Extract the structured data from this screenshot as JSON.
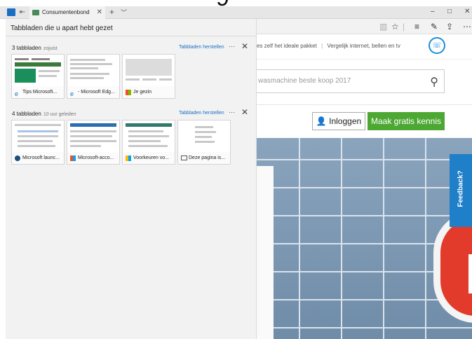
{
  "browser": {
    "tab_title": "Consumentenbond",
    "new_tab_symbol": "+",
    "tab_list_symbol": "﹀",
    "window_controls": [
      "–",
      "□",
      "✕"
    ]
  },
  "panel": {
    "title": "Tabbladen die u apart hebt gezet",
    "groups": [
      {
        "count_label": "3 tabbladen",
        "time_label": "zojuist",
        "restore_label": "Tabbladen herstellen",
        "more_label": "···",
        "close_label": "✕",
        "tabs": [
          {
            "label": "Tips Microsoft...",
            "icon": "edge-icon"
          },
          {
            "label": "- Microsoft Edg...",
            "icon": "edge-icon"
          },
          {
            "label": "Je gezin",
            "icon": "microsoft-logo-icon"
          }
        ]
      },
      {
        "count_label": "4 tabbladen",
        "time_label": "10 uur geleden",
        "restore_label": "Tabbladen herstellen",
        "more_label": "···",
        "close_label": "✕",
        "tabs": [
          {
            "label": "Microsoft launc...",
            "icon": "globe-icon"
          },
          {
            "label": "Microsoft-acco...",
            "icon": "microsoft-logo-icon"
          },
          {
            "label": "Voorkeuren vo...",
            "icon": "microsoft-logo-icon"
          },
          {
            "label": "Deze pagina is...",
            "icon": "page-icon"
          }
        ]
      }
    ]
  },
  "site": {
    "top_text_1": "es zelf het ideale pakket",
    "top_sep": "|",
    "top_text_2": "Vergelijk internet, bellen en tv",
    "search_placeholder": "wasmachine beste koop 2017",
    "login_label": "Inloggen",
    "join_label": "Maak gratis kennis",
    "feedback_label": "Feedback?"
  },
  "colors": {
    "accent_green": "#4ca832",
    "link_blue": "#1a6fc4",
    "feedback_blue": "#1f7fc8"
  }
}
